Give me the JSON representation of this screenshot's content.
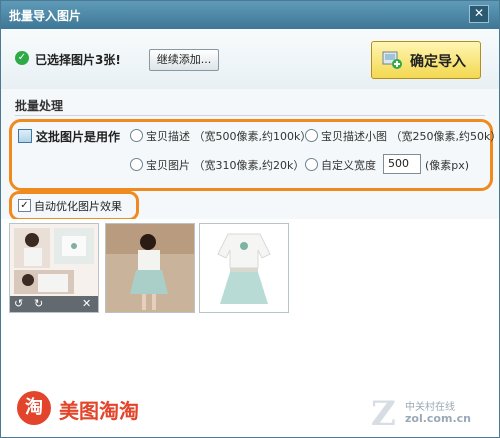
{
  "window": {
    "title": "批量导入图片"
  },
  "header": {
    "selected_text": "已选择图片3张!",
    "continue_label": "继续添加...",
    "import_label": "确定导入"
  },
  "batch": {
    "section_label": "批量处理",
    "usage_label": "这批图片是用作",
    "options": [
      {
        "label": "宝贝描述 （宽500像素,约100k）"
      },
      {
        "label": "宝贝描述小图 （宽250像素,约50k）"
      },
      {
        "label": "宝贝图片 （宽310像素,约20k）"
      },
      {
        "label": "自定义宽度"
      }
    ],
    "custom_width_value": "500",
    "custom_width_unit": "(像素px)"
  },
  "optimize": {
    "label": "自动优化图片效果",
    "checked": true
  },
  "brand": {
    "icon_char": "淘",
    "name": "美图淘淘"
  },
  "watermark": {
    "cn": "中关村在线",
    "url": "zol.com.cn"
  }
}
